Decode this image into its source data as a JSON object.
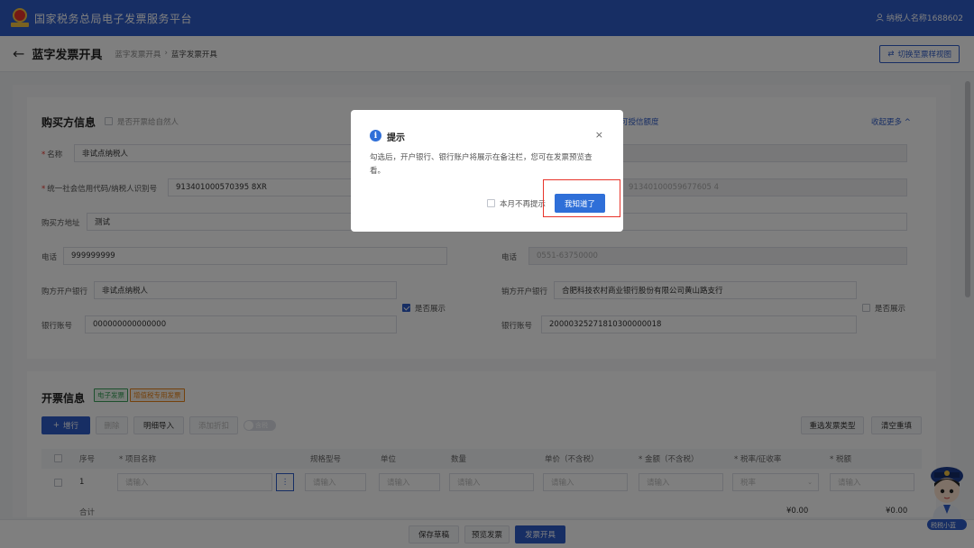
{
  "app": {
    "title": "国家税务总局电子发票服务平台",
    "user": "纳税人名称1688602"
  },
  "header": {
    "back_icon": "arrow-left-icon",
    "page_title": "蓝字发票开具",
    "breadcrumbs": [
      "蓝字发票开具",
      "›",
      "蓝字发票开具"
    ],
    "switch_label": "切换至票样视图"
  },
  "buyer": {
    "title": "购买方信息",
    "natural_person_label": "是否开票给自然人",
    "name_label": "名称",
    "name_value": "非试点纳税人",
    "taxid_label": "统一社会信用代码/纳税人识别号",
    "taxid_value": "913401000570395 8XR",
    "address_label": "购买方地址",
    "address_value": "测试",
    "phone_label": "电话",
    "phone_value": "999999999",
    "bank_label": "购方开户银行",
    "bank_value": "非试点纳税人",
    "account_label": "银行账号",
    "account_value": "000000000000000",
    "show_label": "是否展示"
  },
  "seller": {
    "quota_link": "可授信额度",
    "collapse_label": "收起更多",
    "taxid_value": "91340100059677605 4",
    "phone_label": "电话",
    "phone_value": "0551-63750000",
    "bank_label": "销方开户银行",
    "bank_value": "合肥科技农村商业银行股份有限公司黄山路支行",
    "account_label": "银行账号",
    "account_value": "20000325271810300000018",
    "show_label": "是否展示"
  },
  "invoice": {
    "title": "开票信息",
    "tag_electronic": "电子发票",
    "tag_type": "增值税专用发票",
    "add_row": "增行",
    "delete": "删除",
    "import": "明细导入",
    "discount": "添加折扣",
    "toggle_text": "含税",
    "reselect_type": "重选发票类型",
    "clear": "清空重填",
    "columns": [
      "序号",
      "* 项目名称",
      "规格型号",
      "单位",
      "数量",
      "单价（不含税）",
      "* 金额（不含税）",
      "* 税率/征收率",
      "* 税额"
    ],
    "row_no": "1",
    "placeholder": "请输入",
    "rate_placeholder": "税率",
    "total_label": "合计",
    "total_amount": "¥0.00",
    "total_tax": "¥0.00"
  },
  "footer": {
    "save": "保存草稿",
    "preview": "预览发票",
    "issue": "发票开具"
  },
  "modal": {
    "title": "提示",
    "close": "×",
    "body": "勾选后，开户银行、银行账户将展示在备注栏，您可在发票预览查看。",
    "dont_show_label": "本月不再提示",
    "ok_label": "我知道了"
  },
  "mascot_caption": "税税小蓝"
}
